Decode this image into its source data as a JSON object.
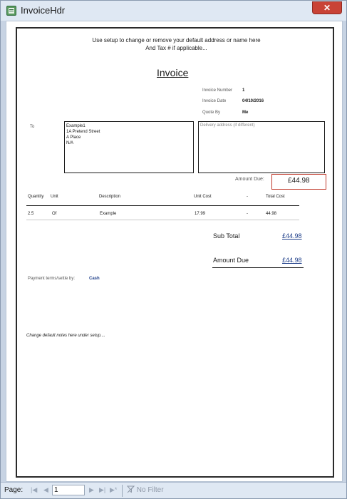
{
  "window": {
    "title": "InvoiceHdr",
    "close_glyph": "✕",
    "icon": "access-report-icon"
  },
  "report": {
    "instruction_line1": "Use setup to change or remove your default address or name here",
    "instruction_line2": "And Tax # if applicable...",
    "title": "Invoice",
    "invoice_number_label": "Invoice Number",
    "invoice_number_value": "1",
    "invoice_date_label": "Invoice Date",
    "invoice_date_value": "04/10/2016",
    "quote_by_label": "Quote By",
    "quote_by_value": "Me",
    "to_label": "To",
    "address_lines": [
      "Example1",
      "1A Pretend Street",
      "A Place",
      "N/A"
    ],
    "delivery_placeholder": "Delivery address (if different)",
    "amount_due_label": "Amount Due:",
    "amount_due_value": "£44.98",
    "columns": {
      "quantity": "Quantity",
      "unit": "Unit",
      "description": "Description",
      "unit_cost": "Unit Cost",
      "dash": "-",
      "total_cost": "Total Cost"
    },
    "line_items": [
      {
        "quantity": "2.5",
        "unit": "Of",
        "description": "Example",
        "unit_cost": "17.99",
        "dash": "-",
        "total_cost": "44.98"
      }
    ],
    "sub_total_label": "Sub Total",
    "sub_total_value": "£44.98",
    "amount_due_total_label": "Amount Due",
    "amount_due_total_value": "£44.98",
    "payment_terms_label": "Payment terms/settle by:",
    "payment_terms_value": "Cash",
    "notes": "Change default notes here under setup...."
  },
  "statusbar": {
    "page_label": "Page:",
    "page_value": "1",
    "first": "|◀",
    "prev": "◀",
    "next": "▶",
    "last": "▶|",
    "new": "▶*",
    "filter_label": "No Filter"
  },
  "colors": {
    "amount_box_border": "#c0392b",
    "link_blue": "#1f3f8a",
    "close_red": "#c94336"
  }
}
